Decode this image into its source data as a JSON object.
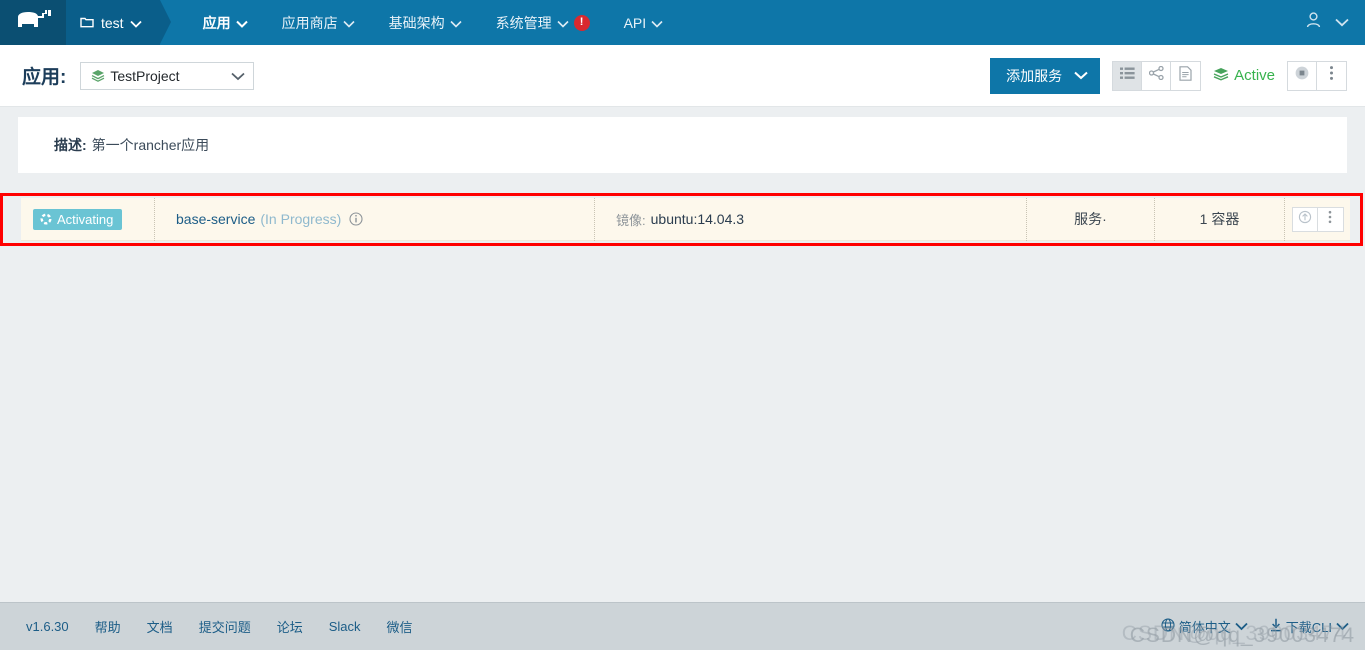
{
  "topnav": {
    "logo_icon": "rancher-cow-logo",
    "environment": {
      "icon": "folder-icon",
      "label": "test",
      "chevron": "chevron-down-icon"
    },
    "items": [
      {
        "label": "应用",
        "active": true
      },
      {
        "label": "应用商店",
        "active": false
      },
      {
        "label": "基础架构",
        "active": false
      },
      {
        "label": "系统管理",
        "active": false,
        "alert": "!"
      },
      {
        "label": "API",
        "active": false
      }
    ],
    "right": {
      "user_icon": "user-icon",
      "chevron": "chevron-down-icon"
    }
  },
  "header": {
    "title": "应用:",
    "project": {
      "icon": "stack-icon",
      "name": "TestProject",
      "chevron": "chevron-down-icon"
    },
    "add_service_label": "添加服务",
    "view_buttons": [
      {
        "name": "list-view",
        "icon": "list-icon",
        "active": true
      },
      {
        "name": "graph-view",
        "icon": "share-icon",
        "active": false
      },
      {
        "name": "config-view",
        "icon": "document-icon",
        "active": false
      }
    ],
    "status": {
      "icon": "stack-icon",
      "label": "Active",
      "color": "#37b24d"
    },
    "action_buttons": [
      {
        "name": "stop-stack",
        "icon": "stop-circle-icon"
      },
      {
        "name": "stack-menu",
        "icon": "kebab-menu-icon"
      }
    ]
  },
  "description": {
    "label": "描述:",
    "value": "第一个rancher应用"
  },
  "service_row": {
    "state": {
      "badge": "Activating",
      "icon": "spinner-icon"
    },
    "name": "base-service",
    "sub_state": "(In Progress)",
    "info_icon": "info-circle-icon",
    "image_label": "镜像:",
    "image_value": "ubuntu:14.04.3",
    "type": "服务·",
    "scale": "1 容器",
    "actions": [
      {
        "name": "upgrade-service",
        "icon": "circle-arrow-up-icon"
      },
      {
        "name": "service-menu",
        "icon": "kebab-menu-icon"
      }
    ]
  },
  "footer": {
    "version": "v1.6.30",
    "links": [
      "帮助",
      "文档",
      "提交问题",
      "论坛",
      "Slack",
      "微信"
    ],
    "language": {
      "icon": "globe-icon",
      "label": "简体中文",
      "chevron": "chevron-down-icon"
    },
    "cli": {
      "icon": "download-icon",
      "label": "下载CLI",
      "chevron": "chevron-down-icon"
    }
  },
  "watermark": {
    "text": "CSDN@qq_39003474",
    "text2": "CSDN@qq_39003474"
  }
}
